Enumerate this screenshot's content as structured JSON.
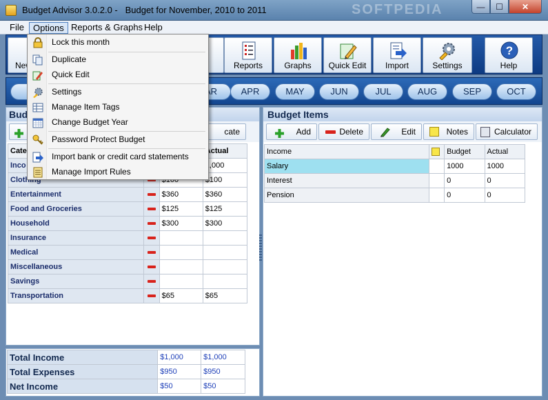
{
  "window": {
    "title": "Budget Advisor 3.0.2.0 -   Budget for November, 2010 to 2011",
    "watermark": "SOFTPEDIA",
    "min_glyph": "—",
    "max_glyph": "☐",
    "close_glyph": "✕"
  },
  "menubar": {
    "file": "File",
    "options": "Options",
    "reports": "Reports & Graphs",
    "help": "Help"
  },
  "toolbar": {
    "new_label": "New",
    "update_label": "te",
    "reports_label": "Reports",
    "graphs_label": "Graphs",
    "quickedit_label": "Quick Edit",
    "import_label": "Import",
    "settings_label": "Settings",
    "help_label": "Help"
  },
  "months": {
    "m0": "N",
    "m1": "AR",
    "m2": "APR",
    "m3": "MAY",
    "m4": "JUN",
    "m5": "JUL",
    "m6": "AUG",
    "m7": "SEP",
    "m8": "OCT"
  },
  "budget_panel": {
    "title": "Budg",
    "dup_label": "cate",
    "col_category": "Cate",
    "col_budget": "",
    "col_actual": "Actual",
    "rows": [
      {
        "name": "Inco",
        "budget": "",
        "actual": "1,000"
      },
      {
        "name": "Clothing",
        "budget": "$100",
        "actual": "$100"
      },
      {
        "name": "Entertainment",
        "budget": "$360",
        "actual": "$360"
      },
      {
        "name": "Food and Groceries",
        "budget": "$125",
        "actual": "$125"
      },
      {
        "name": "Household",
        "budget": "$300",
        "actual": "$300"
      },
      {
        "name": "Insurance",
        "budget": "",
        "actual": ""
      },
      {
        "name": "Medical",
        "budget": "",
        "actual": ""
      },
      {
        "name": "Miscellaneous",
        "budget": "",
        "actual": ""
      },
      {
        "name": "Savings",
        "budget": "",
        "actual": ""
      },
      {
        "name": "Transportation",
        "budget": "$65",
        "actual": "$65"
      }
    ]
  },
  "totals": {
    "income_label": "Total Income",
    "income_budget": "$1,000",
    "income_actual": "$1,000",
    "expenses_label": "Total Expenses",
    "expenses_budget": "$950",
    "expenses_actual": "$950",
    "net_label": "Net Income",
    "net_budget": "$50",
    "net_actual": "$50"
  },
  "items_panel": {
    "title": "Budget Items",
    "add_label": "Add",
    "delete_label": "Delete",
    "edit_label": "Edit",
    "notes_label": "Notes",
    "calculator_label": "Calculator",
    "col_name": "Income",
    "col_budget": "Budget",
    "col_actual": "Actual",
    "rows": [
      {
        "name": "Salary",
        "budget": "1000",
        "actual": "1000"
      },
      {
        "name": "Interest",
        "budget": "0",
        "actual": "0"
      },
      {
        "name": "Pension",
        "budget": "0",
        "actual": "0"
      }
    ]
  },
  "options_menu": {
    "lock": "Lock this month",
    "duplicate": "Duplicate",
    "quick_edit": "Quick Edit",
    "settings": "Settings",
    "manage_tags": "Manage Item Tags",
    "change_year": "Change Budget Year",
    "password": "Password Protect Budget",
    "import_statements": "Import bank or credit card statements",
    "import_rules": "Manage Import Rules"
  },
  "colors": {
    "accent": "#1d4f9c",
    "selected_row": "#9ee0f0",
    "minus_red": "#d8231c",
    "add_green": "#2aa02a"
  }
}
